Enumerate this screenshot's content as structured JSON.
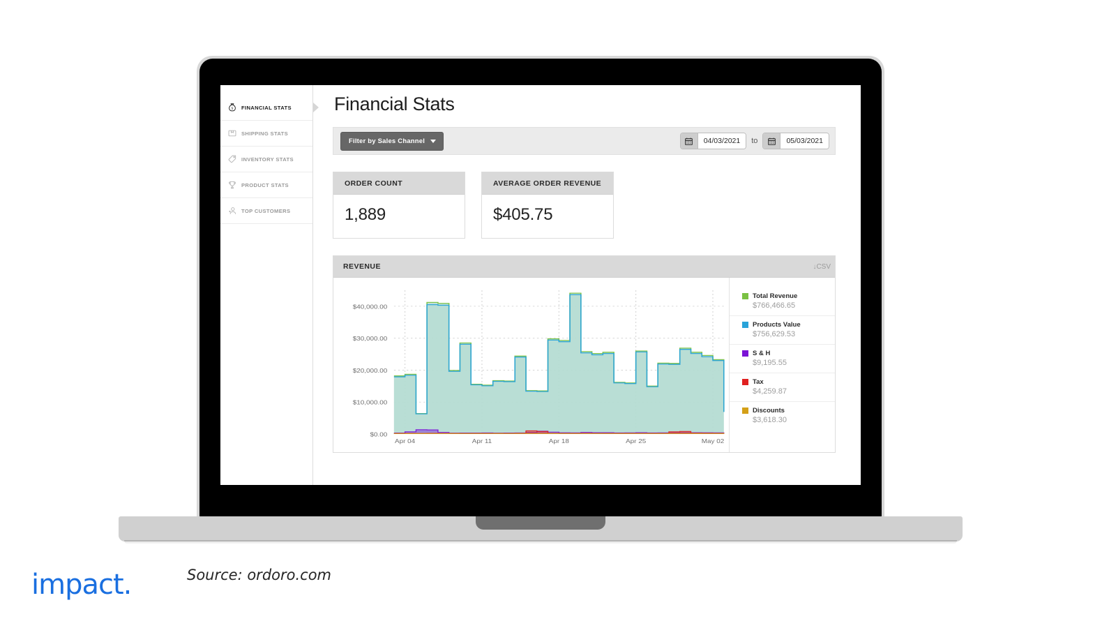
{
  "sidebar": {
    "items": [
      {
        "label": "FINANCIAL STATS",
        "icon": "money-bag-icon",
        "active": true
      },
      {
        "label": "SHIPPING STATS",
        "icon": "box-icon",
        "active": false
      },
      {
        "label": "INVENTORY STATS",
        "icon": "tag-icon",
        "active": false
      },
      {
        "label": "PRODUCT STATS",
        "icon": "trophy-icon",
        "active": false
      },
      {
        "label": "TOP CUSTOMERS",
        "icon": "customer-icon",
        "active": false
      }
    ]
  },
  "page": {
    "title": "Financial Stats"
  },
  "filter_bar": {
    "filter_button_label": "Filter by Sales Channel",
    "caret_icon": "chevron-down-icon",
    "calendar_icon": "calendar-icon",
    "start_date": "04/03/2021",
    "to_label": "to",
    "end_date": "05/03/2021"
  },
  "kpis": [
    {
      "title": "ORDER COUNT",
      "value": "1,889"
    },
    {
      "title": "AVERAGE ORDER REVENUE",
      "value": "$405.75"
    }
  ],
  "revenue_panel": {
    "title": "REVENUE",
    "csv_label": "↓CSV",
    "download_icon": "download-arrow-icon"
  },
  "legend": [
    {
      "name": "Total Revenue",
      "value": "$766,466.65",
      "color": "#7ac143"
    },
    {
      "name": "Products Value",
      "value": "$756,629.53",
      "color": "#29a3d9"
    },
    {
      "name": "S & H",
      "value": "$9,195.55",
      "color": "#7b13d6"
    },
    {
      "name": "Tax",
      "value": "$4,259.87",
      "color": "#e02020"
    },
    {
      "name": "Discounts",
      "value": "$3,618.30",
      "color": "#d4a018"
    }
  ],
  "footer": {
    "logo": "impact.",
    "logo_color": "#1a6fe0",
    "source": "Source: ordoro.com"
  },
  "chart_data": {
    "type": "area",
    "title": "REVENUE",
    "xlabel": "",
    "ylabel": "",
    "ylim": [
      0,
      45000
    ],
    "grid": true,
    "legend_position": "right",
    "y_ticks": [
      "$0.00",
      "$10,000.00",
      "$20,000.00",
      "$30,000.00",
      "$40,000.00"
    ],
    "y_tick_values": [
      0,
      10000,
      20000,
      30000,
      40000
    ],
    "x_ticks": [
      "Apr 04",
      "Apr 11",
      "Apr 18",
      "Apr 25",
      "May 02"
    ],
    "x_tick_indices": [
      1,
      8,
      15,
      22,
      29
    ],
    "x": [
      "Apr 03",
      "Apr 04",
      "Apr 05",
      "Apr 06",
      "Apr 07",
      "Apr 08",
      "Apr 09",
      "Apr 10",
      "Apr 11",
      "Apr 12",
      "Apr 13",
      "Apr 14",
      "Apr 15",
      "Apr 16",
      "Apr 17",
      "Apr 18",
      "Apr 19",
      "Apr 20",
      "Apr 21",
      "Apr 22",
      "Apr 23",
      "Apr 24",
      "Apr 25",
      "Apr 26",
      "Apr 27",
      "Apr 28",
      "Apr 29",
      "Apr 30",
      "May 01",
      "May 02",
      "May 03"
    ],
    "series": [
      {
        "name": "Total Revenue",
        "color": "#7ac143",
        "values": [
          18200,
          18700,
          6400,
          41200,
          40900,
          19900,
          28500,
          15600,
          15300,
          16700,
          16600,
          24400,
          13600,
          13500,
          29800,
          29300,
          44100,
          25800,
          25200,
          25600,
          16200,
          16000,
          26000,
          15000,
          22200,
          22100,
          26900,
          25600,
          24600,
          23300,
          7000
        ]
      },
      {
        "name": "Products Value",
        "color": "#29a3d9",
        "values": [
          17900,
          18400,
          6300,
          40500,
          40300,
          19600,
          28100,
          15400,
          15100,
          16500,
          16400,
          24100,
          13400,
          13300,
          29400,
          28900,
          43600,
          25400,
          24800,
          25200,
          16000,
          15800,
          25700,
          14800,
          21900,
          21800,
          26500,
          25200,
          24200,
          23000,
          6900
        ]
      },
      {
        "name": "S & H",
        "color": "#7b13d6",
        "values": [
          320,
          700,
          1350,
          1300,
          500,
          300,
          320,
          330,
          350,
          300,
          320,
          340,
          500,
          900,
          600,
          400,
          380,
          500,
          430,
          420,
          340,
          360,
          420,
          340,
          380,
          400,
          430,
          420,
          400,
          380,
          120
        ]
      },
      {
        "name": "Tax",
        "color": "#e02020",
        "values": [
          180,
          200,
          210,
          230,
          200,
          170,
          160,
          180,
          170,
          180,
          190,
          230,
          1000,
          800,
          240,
          220,
          210,
          230,
          220,
          210,
          190,
          200,
          220,
          190,
          200,
          700,
          800,
          280,
          250,
          230,
          80
        ]
      },
      {
        "name": "Discounts",
        "color": "#d4a018",
        "values": [
          150,
          160,
          170,
          190,
          170,
          140,
          150,
          150,
          140,
          150,
          160,
          180,
          200,
          180,
          200,
          180,
          170,
          190,
          180,
          170,
          160,
          170,
          180,
          160,
          170,
          200,
          210,
          200,
          190,
          180,
          60
        ]
      }
    ]
  }
}
